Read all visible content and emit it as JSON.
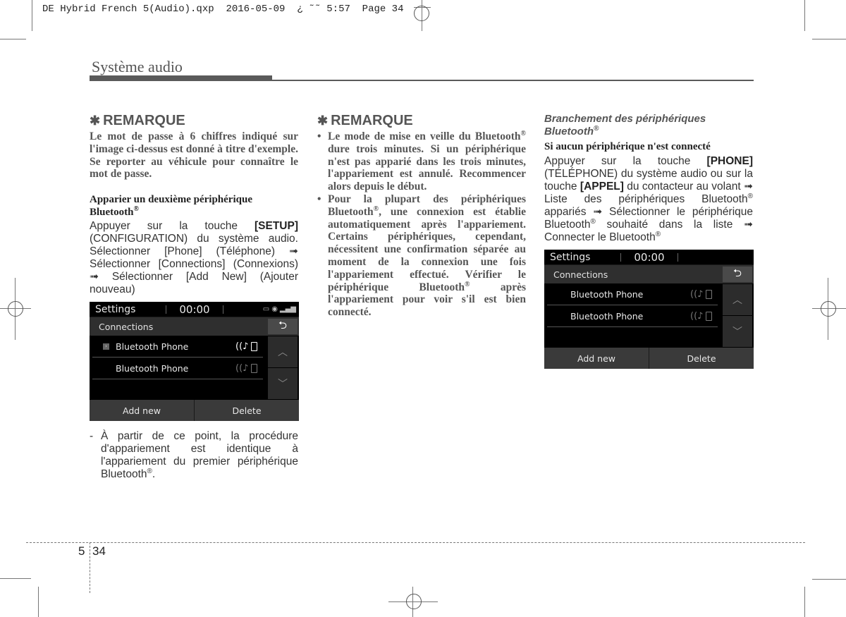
{
  "print_slug": "DE Hybrid French 5(Audio).qxp  2016-05-09  ¿ ˜˜ 5:57  Page 34",
  "section_title": "Système audio",
  "column1": {
    "note_heading": "REMARQUE",
    "note_star": "✱",
    "note_text": "Le mot de passe à 6 chiffres indiqué sur l'image ci-dessus est donné à titre d'exemple. Se reporter au véhicule pour connaître le mot de passe.",
    "subheading": "Apparier un deuxième périphérique Bluetooth",
    "subheading_sup": "®",
    "instructions": {
      "pre": "Appuyer sur la touche ",
      "key": "[SETUP]",
      "post": " (CONFIGURATION) du système audio. Sélectionner [Phone] (Téléphone) ➟ Sélectionner [Connections] (Connexions) ➟ Sélectionner [Add New] (Ajouter nouveau)"
    },
    "dash_item": {
      "dash": "-",
      "text": "À partir de ce point, la procédure d'appariement est identique à l'appariement du premier périphérique Bluetooth",
      "sup": "®",
      "end": "."
    }
  },
  "screen1": {
    "title": "Settings",
    "clock": "00:00",
    "status_icons": [
      "battery-icon",
      "bluetooth-icon",
      "signal-icon"
    ],
    "status_glyphs": [
      "▭",
      "◉",
      "▂▄▆"
    ],
    "subtitle": "Connections",
    "back_glyph": "⮌",
    "rows": [
      {
        "name": "Bluetooth Phone",
        "selected": true,
        "audio_glyph": "((♪",
        "active": true
      },
      {
        "name": "Bluetooth Phone",
        "selected": false,
        "audio_glyph": "((♪",
        "active": false
      }
    ],
    "selected_glyph": "›",
    "scroll_up": "︿",
    "scroll_down": "﹀",
    "buttons": [
      "Add new",
      "Delete"
    ]
  },
  "column2": {
    "note_heading": "REMARQUE",
    "note_star": "✱",
    "bullets": [
      {
        "a": "Le mode de mise en veille du Bluetooth",
        "sup": "®",
        "b": " dure trois minutes. Si un périphérique n'est pas apparié dans les trois minutes, l'appariement est annulé. Recommencer alors depuis le début."
      },
      {
        "a": "Pour la plupart des périphériques Bluetooth",
        "sup": "®",
        "b": ", une connexion est établie automatiquement après l'appariement. Certains périphériques, cependant, nécessitent une confirmation séparée au moment de la connexion une fois l'appariement effectué. Vérifier le périphérique Bluetooth",
        "sup2": "®",
        "c": " après l'appariement pour voir s'il est bien connecté."
      }
    ]
  },
  "column3": {
    "italic_heading": "Branchement des périphériques Bluetooth",
    "italic_heading_sup": "®",
    "subheading": "Si aucun périphérique n'est connecté",
    "instructions": {
      "p1": "Appuyer sur la touche ",
      "k1": "[PHONE]",
      "p2": " (TÉLÉPHONE) du système audio ou sur la touche ",
      "k2": "[APPEL]",
      "p3": " du contacteur au volant ➟ Liste des périphériques Bluetooth",
      "s1": "®",
      "p4": " appariés ➟ Sélectionner le périphérique Bluetooth",
      "s2": "®",
      "p5": " souhaité dans la liste ➟ Connecter le Bluetooth",
      "s3": "®"
    }
  },
  "screen2": {
    "title": "Settings",
    "clock": "00:00",
    "subtitle": "Connections",
    "back_glyph": "⮌",
    "rows": [
      {
        "name": "Bluetooth Phone",
        "audio_glyph": "((♪",
        "active": false
      },
      {
        "name": "Bluetooth Phone",
        "audio_glyph": "((♪",
        "active": false
      }
    ],
    "scroll_up": "︿",
    "scroll_down": "﹀",
    "buttons": [
      "Add new",
      "Delete"
    ]
  },
  "footer": {
    "chapter": "5",
    "page": "34"
  }
}
